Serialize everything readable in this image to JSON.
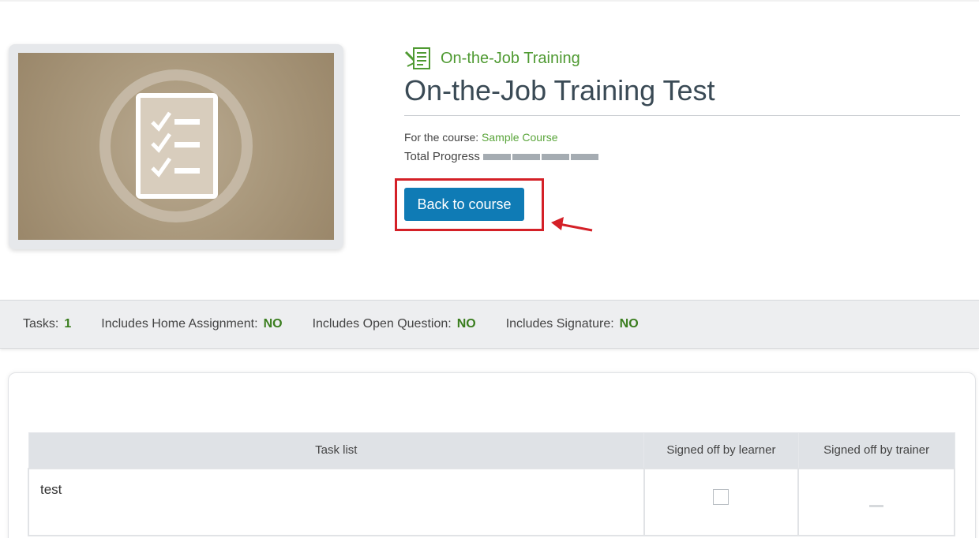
{
  "header": {
    "type_label": "On-the-Job Training",
    "title": "On-the-Job Training Test",
    "course_prefix": "For the course: ",
    "course_name": "Sample Course",
    "progress_label": "Total Progress",
    "progress_segments": 4,
    "progress_completed": 0,
    "back_button": "Back to course"
  },
  "stats": [
    {
      "label": "Tasks:",
      "value": "1"
    },
    {
      "label": "Includes Home Assignment:",
      "value": "NO"
    },
    {
      "label": "Includes Open Question:",
      "value": "NO"
    },
    {
      "label": "Includes Signature:",
      "value": "NO"
    }
  ],
  "table": {
    "headers": [
      "Task list",
      "Signed off by learner",
      "Signed off by trainer"
    ],
    "rows": [
      {
        "task": "test",
        "learner_signed": false,
        "trainer_signed": null
      }
    ]
  },
  "icons": {
    "thumbnail": "checklist-icon",
    "type": "ojt-document-icon",
    "annotation": "red-arrow-icon"
  },
  "colors": {
    "accent_green": "#4f9a32",
    "button_blue": "#0f7bb5",
    "highlight_red": "#d42027"
  }
}
